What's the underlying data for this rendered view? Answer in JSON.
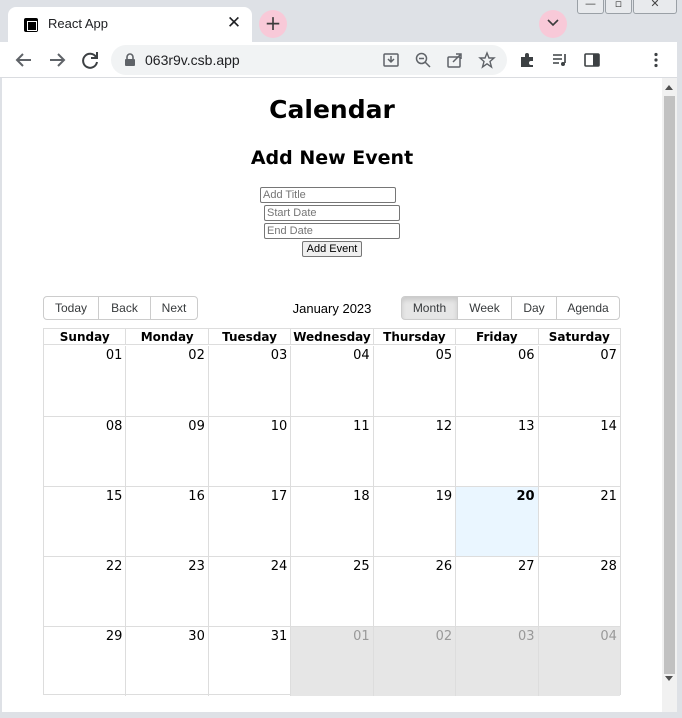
{
  "browser": {
    "tab_title": "React App",
    "new_tab_symbol": "+",
    "tab_close_symbol": "✕",
    "url": "063r9v.csb.app",
    "accent_color": "#f8c9d8"
  },
  "page": {
    "title": "Calendar",
    "form": {
      "heading": "Add New Event",
      "title_placeholder": "Add Title",
      "start_placeholder": "Start Date",
      "end_placeholder": "End Date",
      "submit_label": "Add Event"
    }
  },
  "calendar": {
    "nav_buttons": [
      "Today",
      "Back",
      "Next"
    ],
    "label": "January 2023",
    "views": [
      "Month",
      "Week",
      "Day",
      "Agenda"
    ],
    "active_view": "Month",
    "weekdays": [
      "Sunday",
      "Monday",
      "Tuesday",
      "Wednesday",
      "Thursday",
      "Friday",
      "Saturday"
    ],
    "weeks": [
      [
        "01",
        "02",
        "03",
        "04",
        "05",
        "06",
        "07"
      ],
      [
        "08",
        "09",
        "10",
        "11",
        "12",
        "13",
        "14"
      ],
      [
        "15",
        "16",
        "17",
        "18",
        "19",
        "20",
        "21"
      ],
      [
        "22",
        "23",
        "24",
        "25",
        "26",
        "27",
        "28"
      ],
      [
        "29",
        "30",
        "31",
        "01",
        "02",
        "03",
        "04"
      ]
    ],
    "today": "20",
    "today_color": "#eaf6ff",
    "off_range_color": "#e6e6e6"
  }
}
